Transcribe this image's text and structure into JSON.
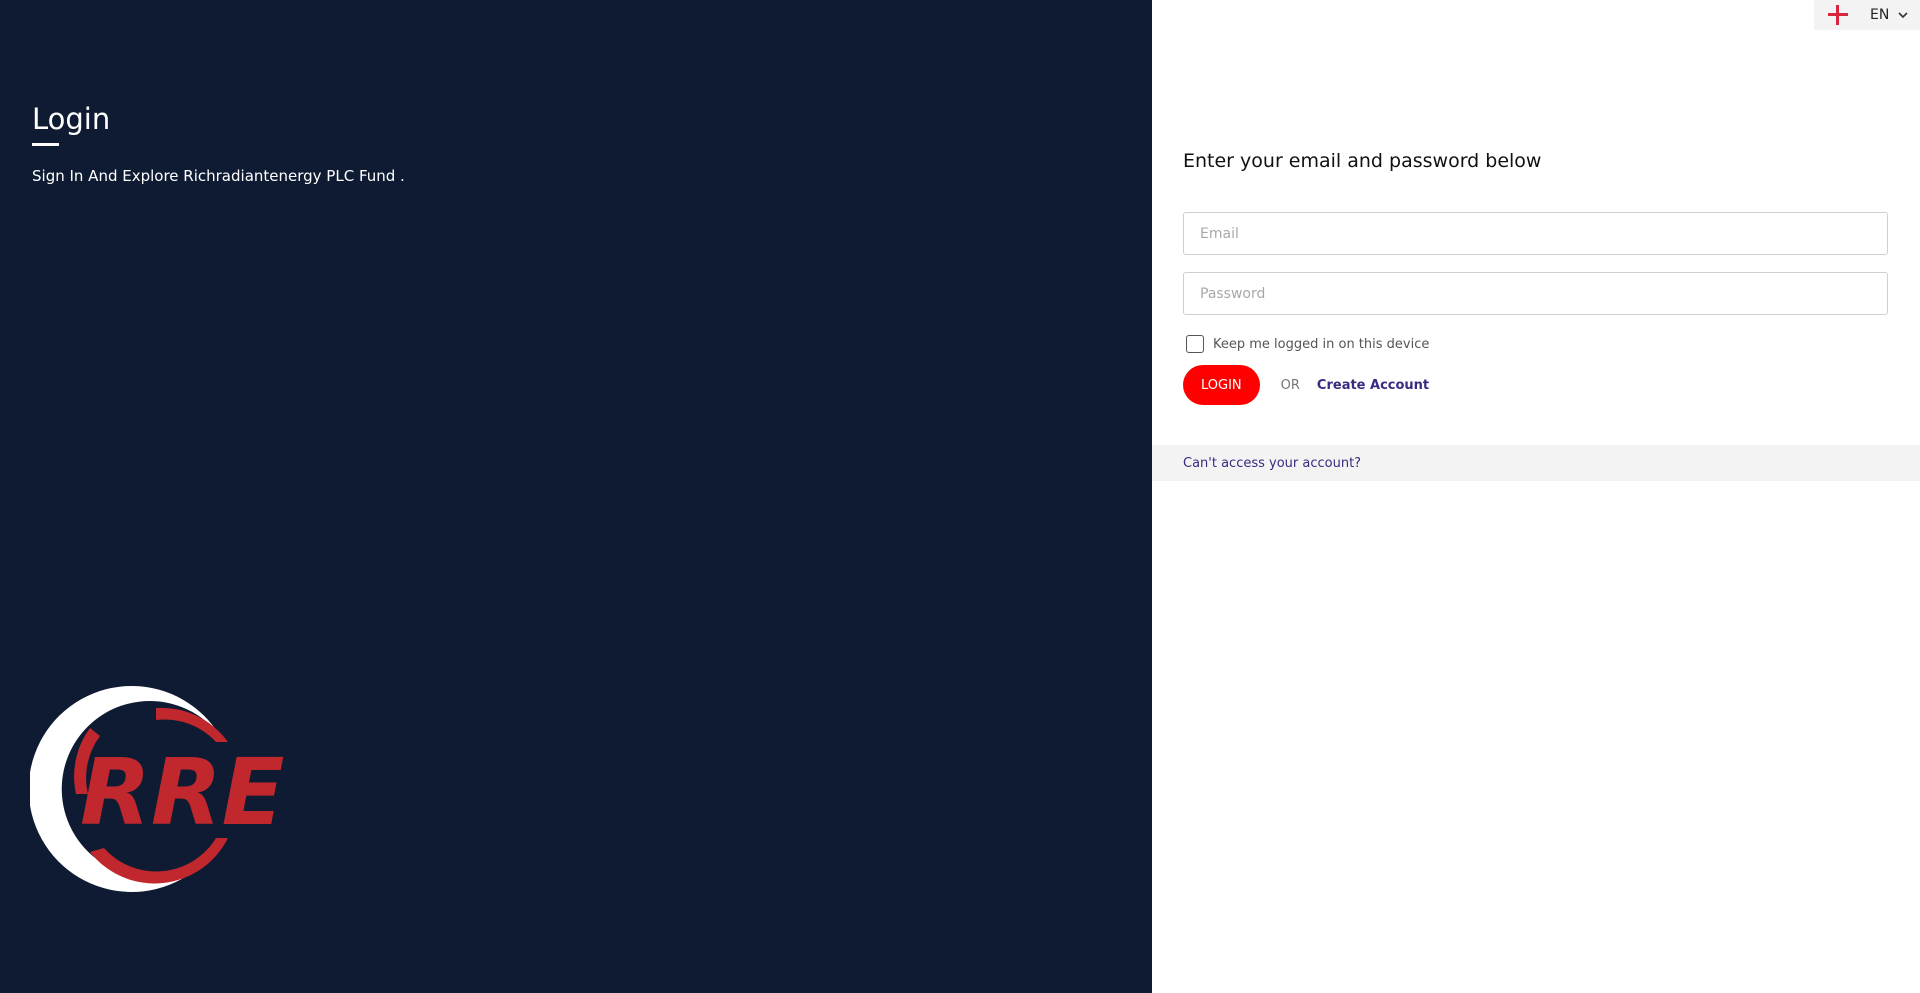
{
  "left": {
    "title": "Login",
    "subtitle": "Sign In And Explore Richradiantenergy PLC Fund .",
    "logo_text": "RRE"
  },
  "language": {
    "flag_icon": "england-flag-icon",
    "label": "EN",
    "chevron_icon": "chevron-down-icon"
  },
  "form": {
    "heading": "Enter your email and password below",
    "email_placeholder": "Email",
    "email_value": "",
    "password_placeholder": "Password",
    "password_value": "",
    "remember_label": "Keep me logged in on this device",
    "remember_checked": false,
    "login_label": "LOGIN",
    "or_label": "OR",
    "create_account_label": "Create Account"
  },
  "footer": {
    "cant_access_label": "Can't access your account?"
  },
  "colors": {
    "left_bg": "#0f1b33",
    "accent_red": "#ff0000",
    "link_purple": "#3a2a80",
    "logo_red": "#c0282d"
  }
}
